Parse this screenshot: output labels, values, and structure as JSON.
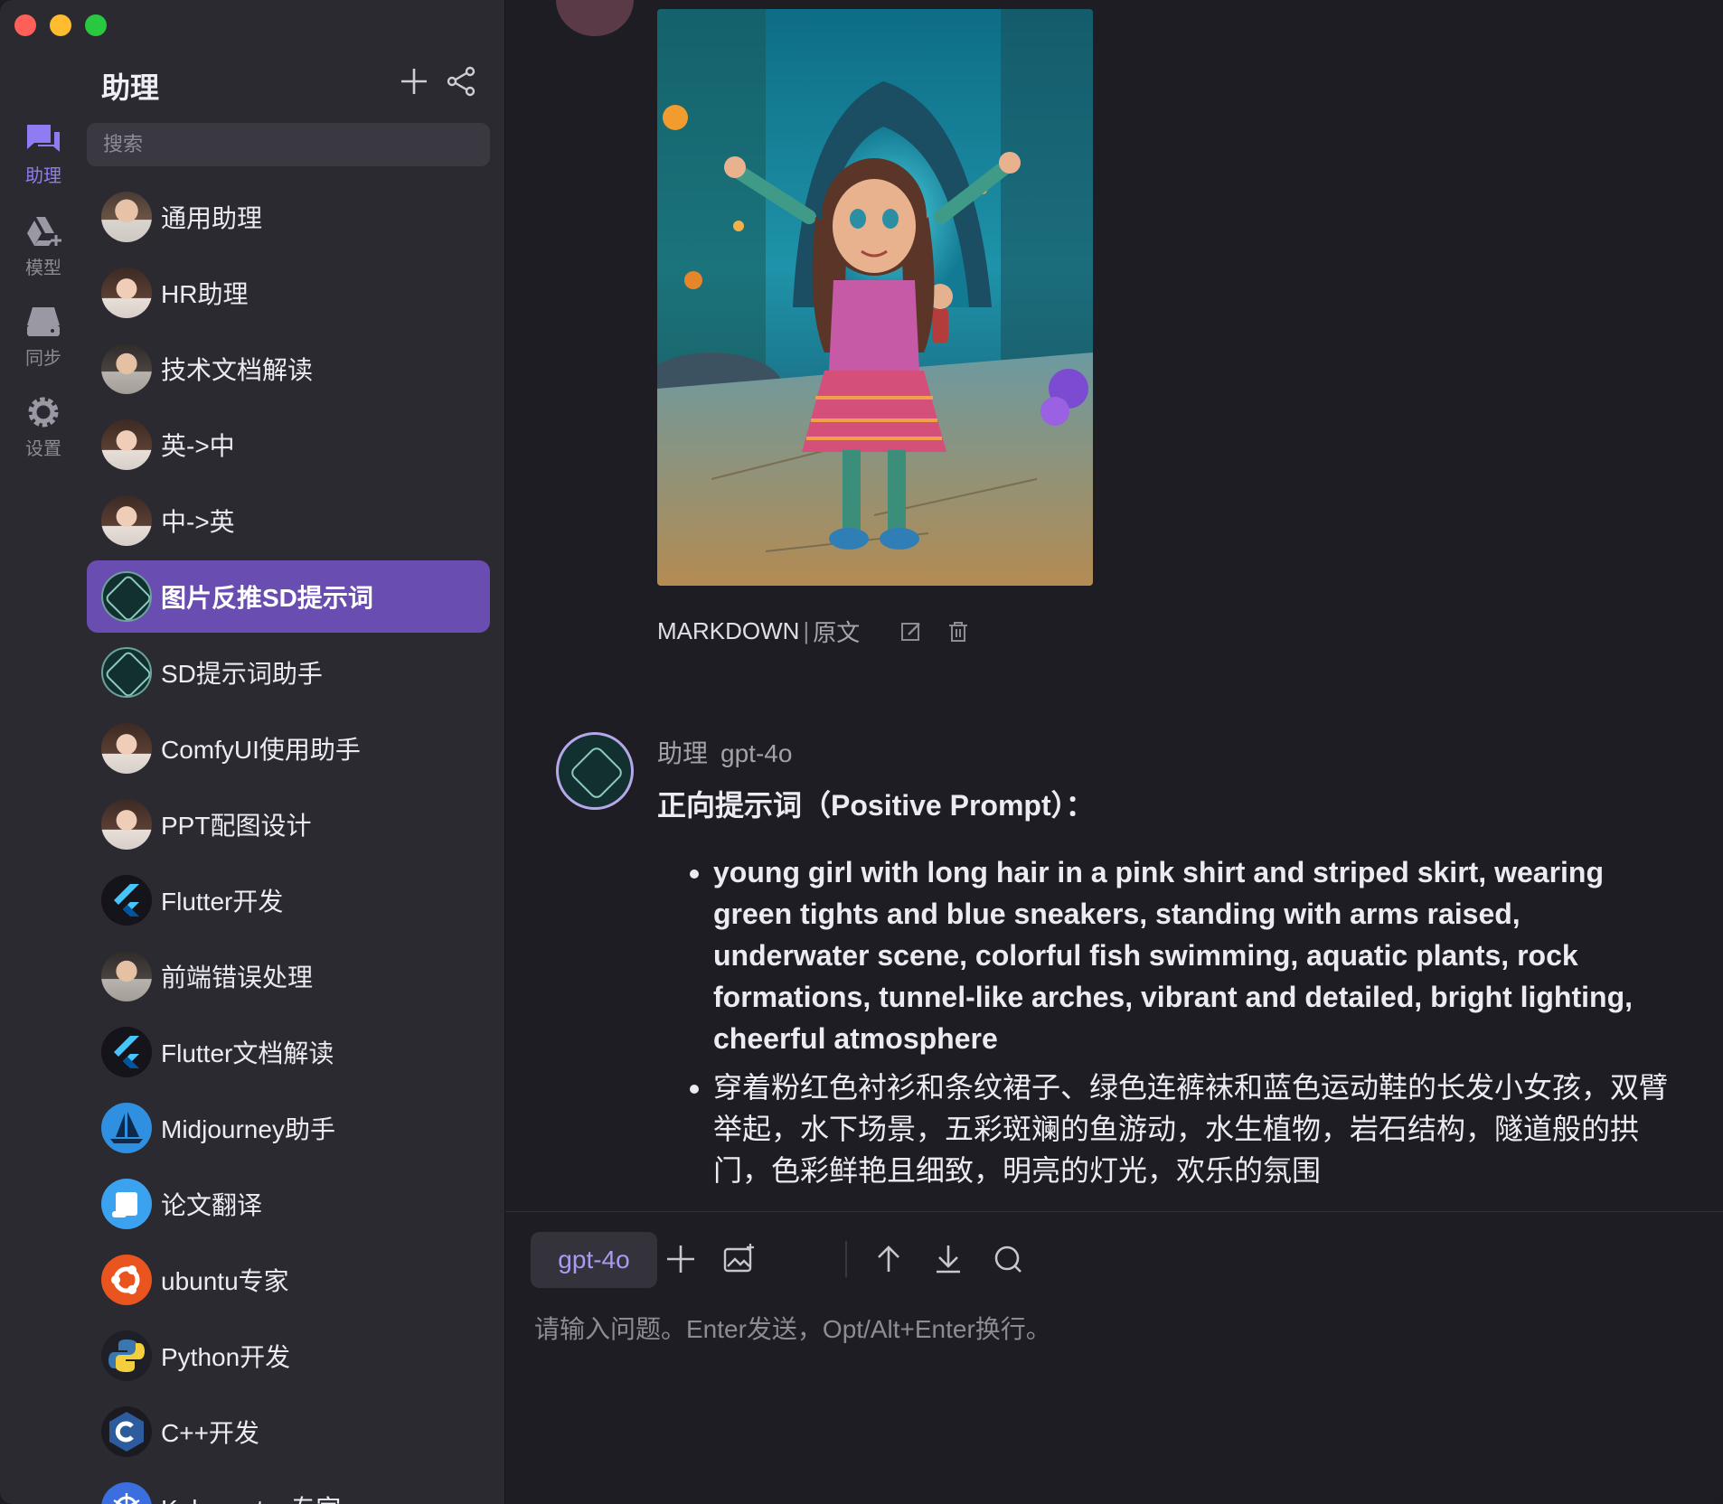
{
  "rail": {
    "items": [
      {
        "label": "助理",
        "icon": "chat-icon",
        "active": true
      },
      {
        "label": "模型",
        "icon": "model-icon"
      },
      {
        "label": "同步",
        "icon": "sync-drive-icon"
      },
      {
        "label": "设置",
        "icon": "gear-icon"
      }
    ]
  },
  "sidebar": {
    "title": "助理",
    "search_placeholder": "搜索",
    "assistants": [
      {
        "name": "通用助理",
        "avatar": "person-avatar"
      },
      {
        "name": "HR助理",
        "avatar": "woman-avatar"
      },
      {
        "name": "技术文档解读",
        "avatar": "man-avatar"
      },
      {
        "name": "英->中",
        "avatar": "woman-avatar"
      },
      {
        "name": "中->英",
        "avatar": "woman-avatar"
      },
      {
        "name": "图片反推SD提示词",
        "avatar": "stable-diffusion-avatar",
        "active": true
      },
      {
        "name": "SD提示词助手",
        "avatar": "stable-diffusion-avatar"
      },
      {
        "name": "ComfyUI使用助手",
        "avatar": "woman-avatar"
      },
      {
        "name": "PPT配图设计",
        "avatar": "woman-avatar"
      },
      {
        "name": "Flutter开发",
        "avatar": "flutter-logo"
      },
      {
        "name": "前端错误处理",
        "avatar": "man-avatar"
      },
      {
        "name": "Flutter文档解读",
        "avatar": "flutter-logo"
      },
      {
        "name": "Midjourney助手",
        "avatar": "midjourney-logo"
      },
      {
        "name": "论文翻译",
        "avatar": "paper-icon"
      },
      {
        "name": "ubuntu专家",
        "avatar": "ubuntu-logo"
      },
      {
        "name": "Python开发",
        "avatar": "python-logo"
      },
      {
        "name": "C++开发",
        "avatar": "cpp-logo"
      },
      {
        "name": "Kubernetes专家",
        "avatar": "kubernetes-logo"
      }
    ]
  },
  "message_user": {
    "image_alt": "animated girl with arms raised in underwater tunnel",
    "view_mode": "MARKDOWN",
    "separator": "|",
    "raw_label": "原文"
  },
  "message_bot": {
    "name": "助理",
    "model": "gpt-4o",
    "heading": "正向提示词（Positive Prompt）：",
    "bullets": [
      "young girl with long hair in a pink shirt and striped skirt, wearing green tights and blue sneakers, standing with arms raised, underwater scene, colorful fish swimming, aquatic plants, rock formations, tunnel-like arches, vibrant and detailed, bright lighting, cheerful atmosphere",
      "穿着粉红色衬衫和条纹裙子、绿色连裤袜和蓝色运动鞋的长发小女孩，双臂举起，水下场景，五彩斑斓的鱼游动，水生植物，岩石结构，隧道般的拱门，色彩鲜艳且细致，明亮的灯光，欢乐的氛围"
    ]
  },
  "composer": {
    "model_chip": "gpt-4o",
    "placeholder": "请输入问题。Enter发送，Opt/Alt+Enter换行。"
  },
  "colors": {
    "accent": "#6a4db0",
    "accent_text": "#8f7cf3",
    "background": "#1e1d23",
    "sidebar": "#2b2a31"
  }
}
